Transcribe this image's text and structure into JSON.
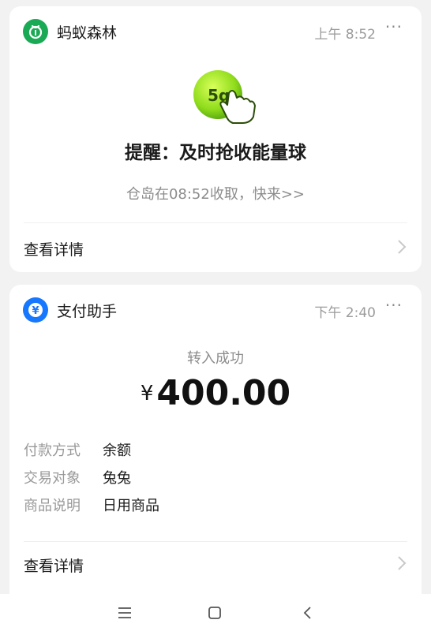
{
  "card1": {
    "app_name": "蚂蚁森林",
    "time": "上午 8:52",
    "more": "···",
    "ball_text": "5g",
    "title": "提醒：及时抢收能量球",
    "subtitle": "仓岛在08:52收取，快来>>",
    "detail_label": "查看详情",
    "icon_color": "#1aaa55"
  },
  "card2": {
    "app_name": "支付助手",
    "time": "下午 2:40",
    "more": "···",
    "status": "转入成功",
    "currency": "¥",
    "amount": "400.00",
    "icon_color": "#1677ff",
    "info": [
      {
        "key": "付款方式",
        "value": "余额"
      },
      {
        "key": "交易对象",
        "value": "兔兔"
      },
      {
        "key": "商品说明",
        "value": "日用商品"
      }
    ],
    "detail_label": "查看详情"
  },
  "nav": {
    "menu_icon": "menu-icon",
    "home_icon": "home-icon",
    "back_icon": "back-icon"
  }
}
